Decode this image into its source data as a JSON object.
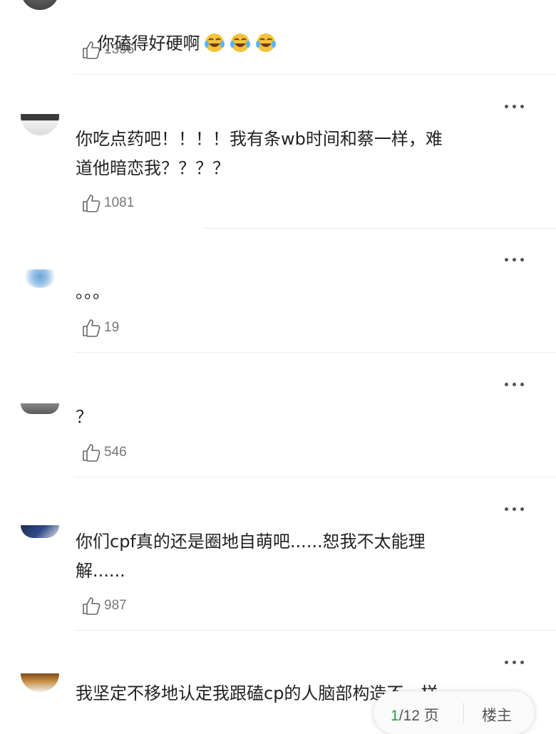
{
  "comments": [
    {
      "text": "你磕得好硬啊",
      "emoji": [
        "laughing-tears",
        "laughing-tears",
        "laughing-tears"
      ],
      "likes": "1356"
    },
    {
      "text": "你吃点药吧！！！！我有条wb时间和蔡一样，难\n道他暗恋我？？？？",
      "likes": "1081"
    },
    {
      "text": "。。。",
      "likes": "19"
    },
    {
      "text": "？",
      "likes": "546"
    },
    {
      "text": "你们cpf真的还是圈地自萌吧......恕我不太能理\n解......",
      "likes": "987"
    },
    {
      "text": "我坚定不移地认定我跟磕cp的人脑部构造不一样"
    }
  ],
  "pager": {
    "current": "1",
    "total_suffix": "/12 页",
    "floor_label": "楼主"
  },
  "colors": {
    "accent": "#2a9d4a",
    "count": "#777777",
    "text": "#222222"
  }
}
